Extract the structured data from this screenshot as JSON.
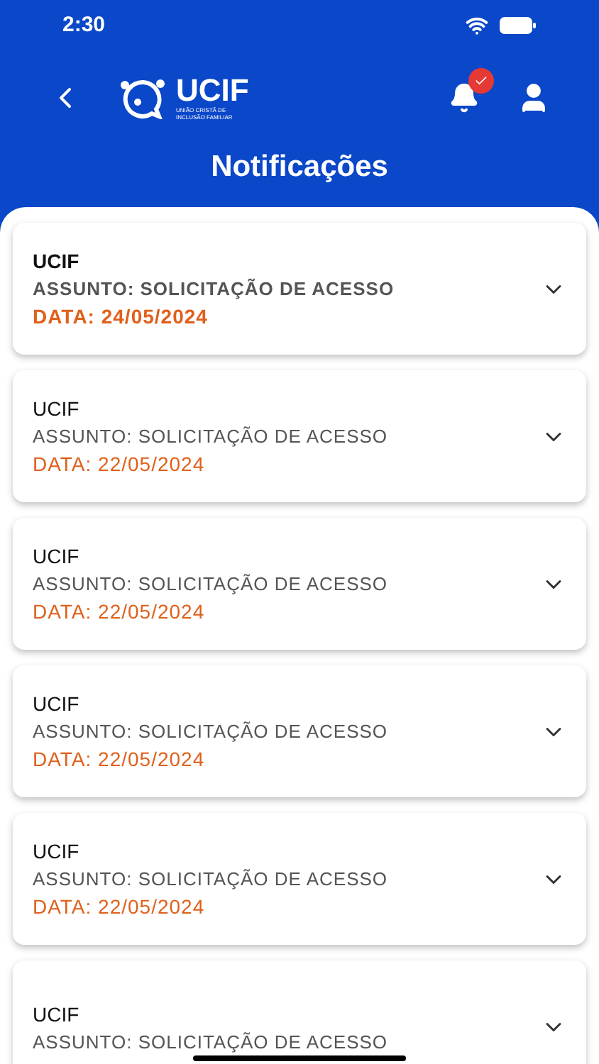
{
  "status_bar": {
    "time": "2:30"
  },
  "header": {
    "logo_text": "UCIF",
    "logo_subtitle": "UNIÃO CRISTÃ DE INCLUSÃO FAMILIAR",
    "has_new_notifications": true,
    "title": "Notificações"
  },
  "notifications": [
    {
      "sender": "UCIF",
      "subject": "ASSUNTO: SOLICITAÇÃO DE ACESSO",
      "date": "DATA: 24/05/2024",
      "unread": true
    },
    {
      "sender": "UCIF",
      "subject": "ASSUNTO: SOLICITAÇÃO DE ACESSO",
      "date": "DATA: 22/05/2024",
      "unread": false
    },
    {
      "sender": "UCIF",
      "subject": "ASSUNTO: SOLICITAÇÃO DE ACESSO",
      "date": "DATA: 22/05/2024",
      "unread": false
    },
    {
      "sender": "UCIF",
      "subject": "ASSUNTO: SOLICITAÇÃO DE ACESSO",
      "date": "DATA: 22/05/2024",
      "unread": false
    },
    {
      "sender": "UCIF",
      "subject": "ASSUNTO: SOLICITAÇÃO DE ACESSO",
      "date": "DATA: 22/05/2024",
      "unread": false
    },
    {
      "sender": "UCIF",
      "subject": "ASSUNTO: SOLICITAÇÃO DE ACESSO",
      "unread": false
    }
  ]
}
